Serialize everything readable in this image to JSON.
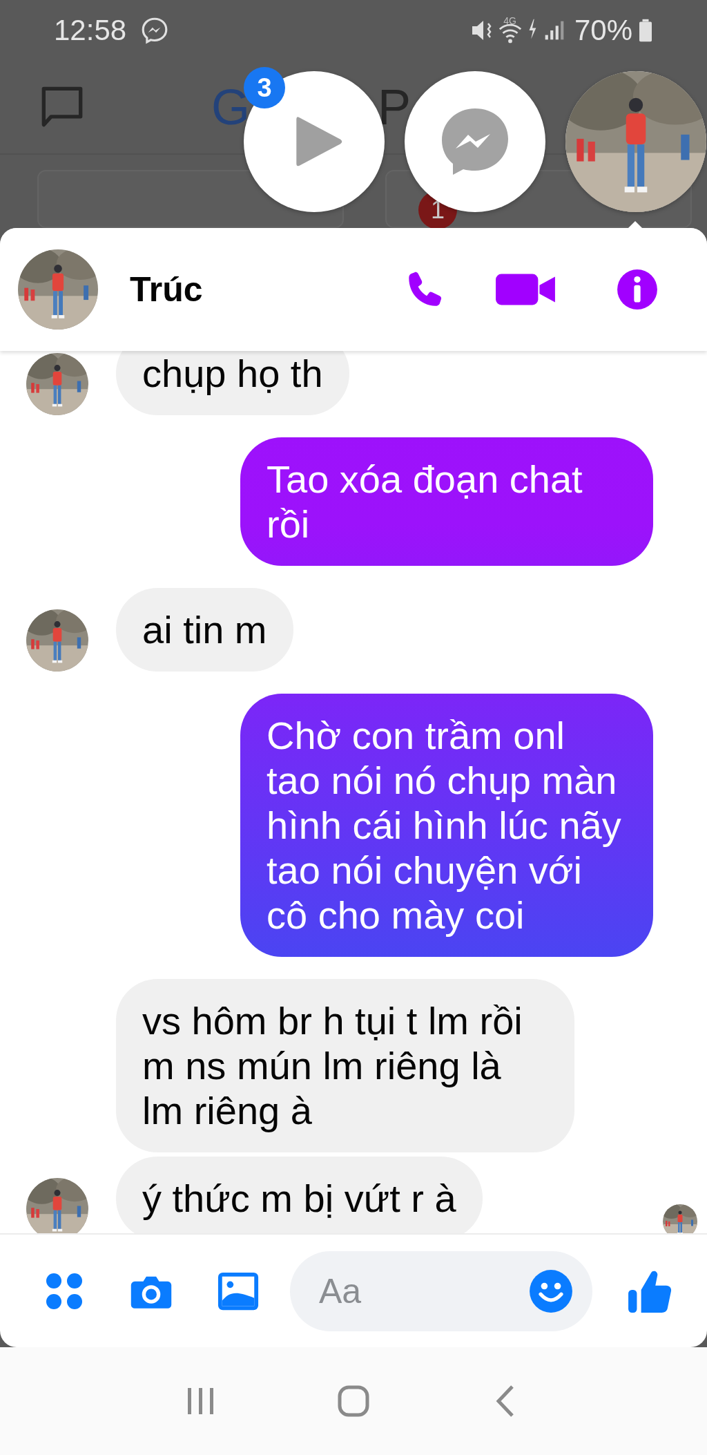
{
  "status_bar": {
    "time": "12:58",
    "network": "4G",
    "battery": "70%"
  },
  "background_app": {
    "logo_letter": "G",
    "title_fragment": "P",
    "badge": "1"
  },
  "chat_heads": [
    {
      "kind": "play",
      "badge": "3",
      "selected": false
    },
    {
      "kind": "messenger",
      "selected": false
    },
    {
      "kind": "contact",
      "selected": true
    }
  ],
  "conversation": {
    "contact_name": "Trúc"
  },
  "messages": [
    {
      "kind": "incoming",
      "show_avatar": true,
      "text": "chụp họ th"
    },
    {
      "kind": "outgoing",
      "text": "Tao xóa đoạn chat rồi"
    },
    {
      "kind": "incoming",
      "show_avatar": true,
      "text": "ai tin m"
    },
    {
      "kind": "outgoing",
      "text": "Chờ con trầm onl tao nói nó chụp màn hình cái hình lúc nãy tao nói chuyện với cô cho mày coi"
    },
    {
      "kind": "incoming",
      "show_avatar": false,
      "text": "vs hôm br h tụi t lm rồi m ns mún lm riêng là lm riêng à"
    },
    {
      "kind": "incoming",
      "show_avatar": true,
      "text": "ý thức m bị vứt r à"
    }
  ],
  "composer": {
    "placeholder": "Aa"
  }
}
